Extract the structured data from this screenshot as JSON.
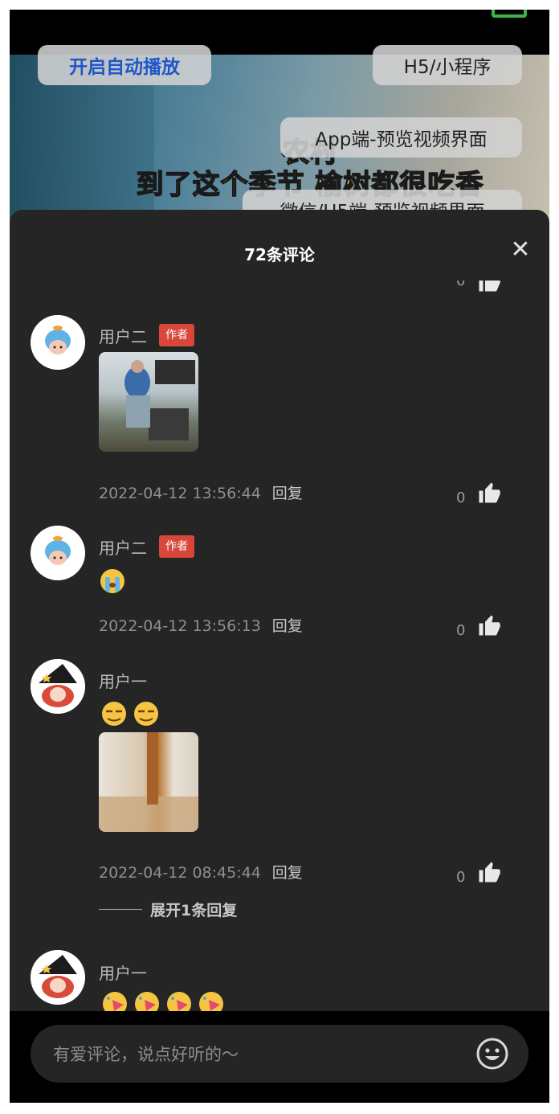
{
  "video": {
    "caption_line1": "农村",
    "caption_line2": "到了这个季节 榆树都很吃香"
  },
  "buttons": {
    "autoplay": "开启自动播放",
    "h5_miniprogram": "H5/小程序",
    "app_preview": "App端-预览视频界面",
    "wechat_preview": "微信/H5端-预览视频界面"
  },
  "comments_panel": {
    "title": "72条评论",
    "close_icon": "close-icon",
    "clipped_like_count": "0",
    "comments": [
      {
        "user": "用户二",
        "author_tag": "作者",
        "has_image": true,
        "time": "2022-04-12 13:56:44",
        "reply_label": "回复",
        "likes": "0"
      },
      {
        "user": "用户二",
        "author_tag": "作者",
        "emoji_count": 1,
        "time": "2022-04-12 13:56:13",
        "reply_label": "回复",
        "likes": "0"
      },
      {
        "user": "用户一",
        "emoji_count": 2,
        "has_image": true,
        "time": "2022-04-12 08:45:44",
        "reply_label": "回复",
        "likes": "0",
        "expand_replies": "展开1条回复"
      },
      {
        "user": "用户一",
        "emoji_count": 4
      }
    ]
  },
  "input": {
    "placeholder": "有爱评论，说点好听的～",
    "emoji_icon": "smiley-icon"
  },
  "colors": {
    "panel_bg": "#252525",
    "author_tag": "#d8473a",
    "autoplay_text": "#1f57c8"
  }
}
